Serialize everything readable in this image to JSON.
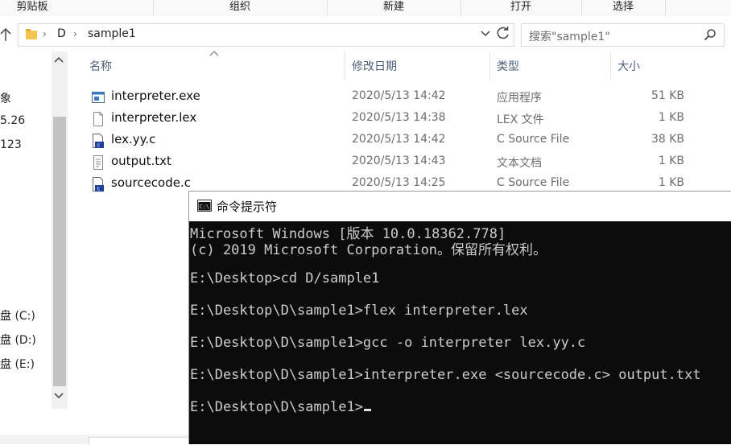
{
  "ribbon": {
    "groups": [
      {
        "label": "剪贴板"
      },
      {
        "label": "组织"
      },
      {
        "label": "新建"
      },
      {
        "label": "打开"
      },
      {
        "label": "选择"
      }
    ]
  },
  "address": {
    "breadcrumbs": [
      "D",
      "sample1"
    ]
  },
  "search": {
    "placeholder": "搜索\"sample1\""
  },
  "nav_pane": {
    "items": [
      "象",
      "5.26",
      "123",
      "盘 (C:)",
      "盘 (D:)",
      "盘 (E:)"
    ]
  },
  "file_list": {
    "columns": {
      "name": "名称",
      "date": "修改日期",
      "type": "类型",
      "size": "大小"
    },
    "files": [
      {
        "name": "interpreter.exe",
        "date": "2020/5/13 14:42",
        "type": "应用程序",
        "size": "51 KB",
        "icon": "exe-file-icon"
      },
      {
        "name": "interpreter.lex",
        "date": "2020/5/13 14:38",
        "type": "LEX 文件",
        "size": "1 KB",
        "icon": "generic-file-icon"
      },
      {
        "name": "lex.yy.c",
        "date": "2020/5/13 14:42",
        "type": "C Source File",
        "size": "38 KB",
        "icon": "c-file-icon"
      },
      {
        "name": "output.txt",
        "date": "2020/5/13 14:43",
        "type": "文本文档",
        "size": "1 KB",
        "icon": "text-file-icon"
      },
      {
        "name": "sourcecode.c",
        "date": "2020/5/13 14:25",
        "type": "C Source File",
        "size": "1 KB",
        "icon": "c-file-icon"
      }
    ]
  },
  "cmd": {
    "title": "命令提示符",
    "lines": [
      "Microsoft Windows [版本 10.0.18362.778]",
      "(c) 2019 Microsoft Corporation。保留所有权利。",
      "",
      "E:\\Desktop>cd D/sample1",
      "",
      "E:\\Desktop\\D\\sample1>flex interpreter.lex",
      "",
      "E:\\Desktop\\D\\sample1>gcc -o interpreter lex.yy.c",
      "",
      "E:\\Desktop\\D\\sample1>interpreter.exe <sourcecode.c> output.txt",
      "",
      "E:\\Desktop\\D\\sample1>"
    ]
  },
  "colors": {
    "console_bg": "#0c0c0c",
    "console_text": "#cccccc",
    "header_text": "#4c607a",
    "muted_text": "#6d6d6d"
  }
}
